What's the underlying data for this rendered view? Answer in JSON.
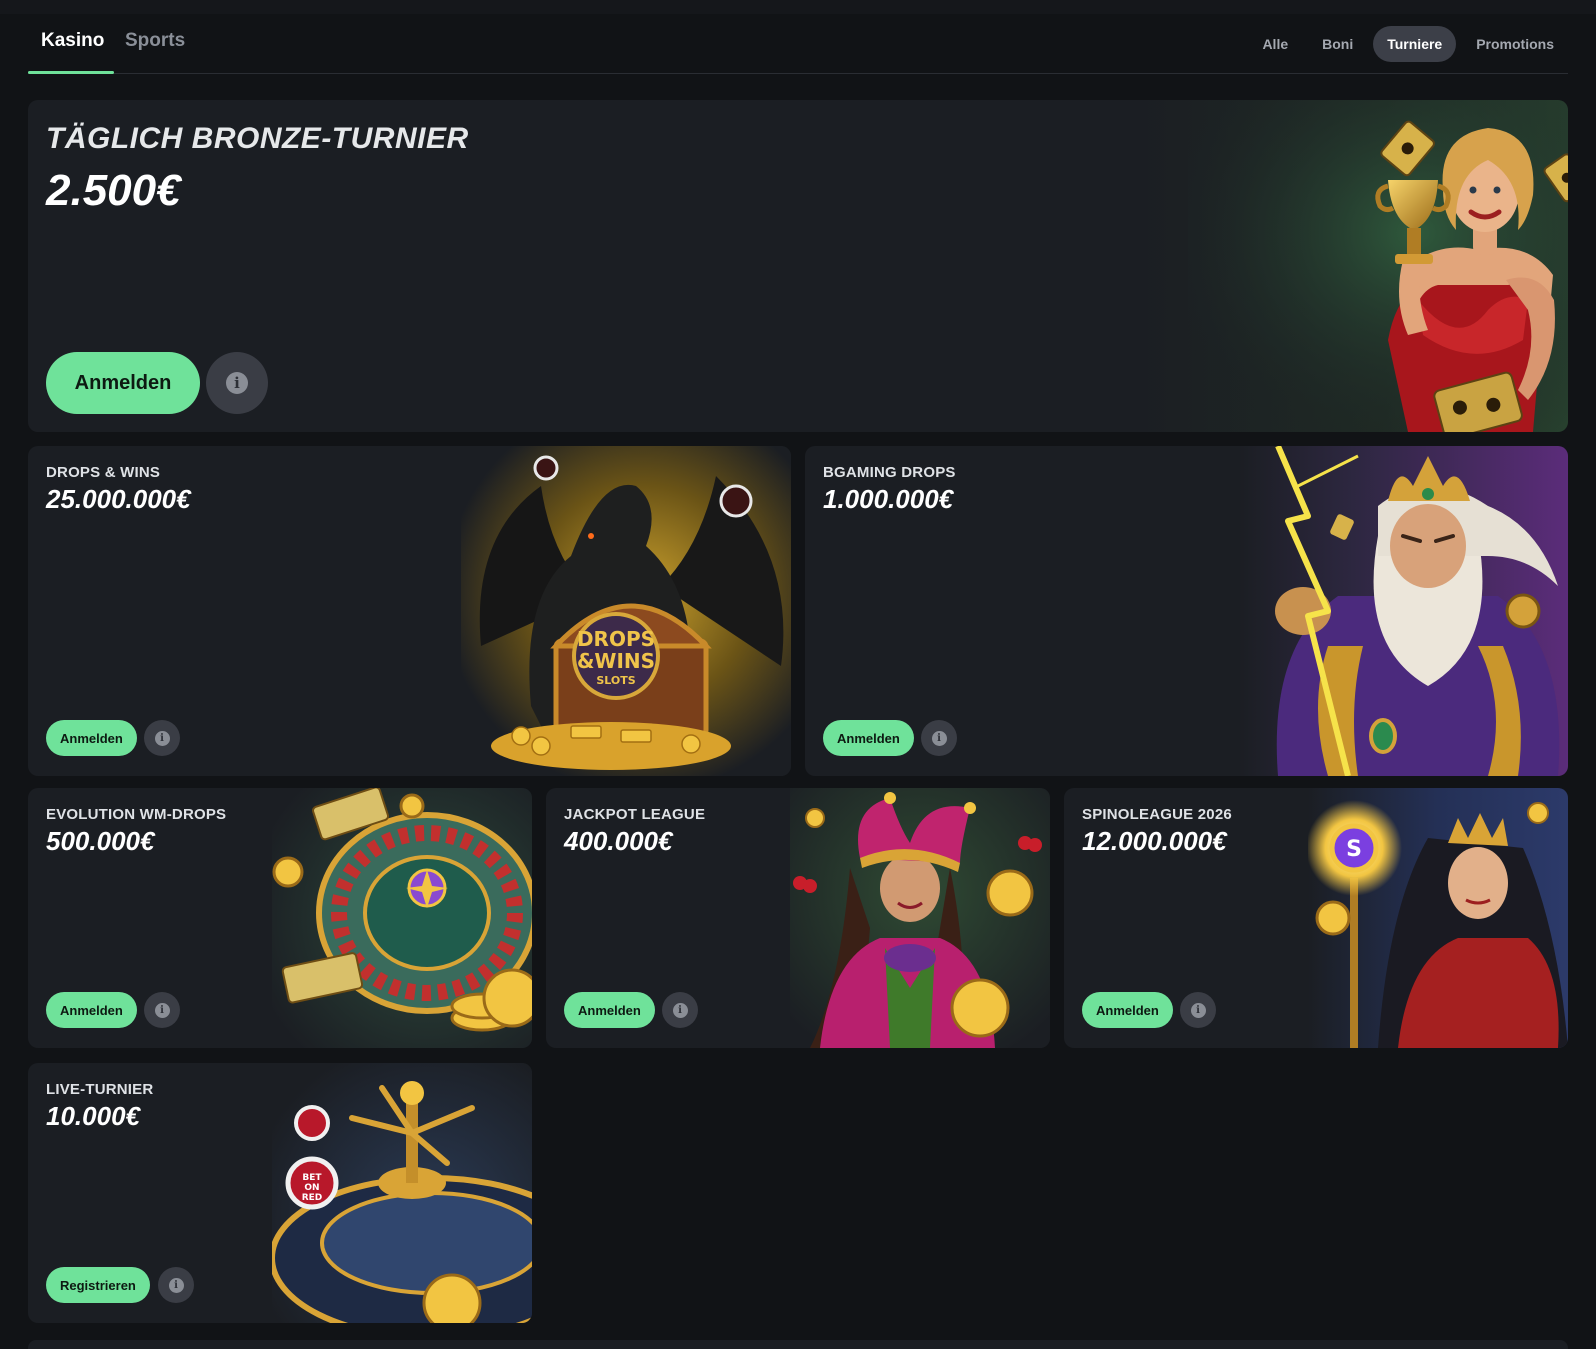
{
  "nav": {
    "tabs": [
      {
        "label": "Kasino",
        "active": true
      },
      {
        "label": "Sports",
        "active": false
      }
    ],
    "filters": [
      {
        "label": "Alle",
        "active": false
      },
      {
        "label": "Boni",
        "active": false
      },
      {
        "label": "Turniere",
        "active": true
      },
      {
        "label": "Promotions",
        "active": false
      }
    ]
  },
  "cards": [
    {
      "title": "TÄGLICH BRONZE-TURNIER",
      "prize": "2.500€",
      "button": "Anmelden",
      "art": "showgirl-trophy-illustration"
    },
    {
      "title": "DROPS & WINS",
      "prize": "25.000.000€",
      "button": "Anmelden",
      "art": "dragon-treasure-chest-illustration",
      "art_text": "DROPS & WINS SLOTS"
    },
    {
      "title": "BGAMING DROPS",
      "prize": "1.000.000€",
      "button": "Anmelden",
      "art": "zeus-lightning-illustration"
    },
    {
      "title": "EVOLUTION WM-DROPS",
      "prize": "500.000€",
      "button": "Anmelden",
      "art": "roulette-wheel-illustration"
    },
    {
      "title": "JACKPOT LEAGUE",
      "prize": "400.000€",
      "button": "Anmelden",
      "art": "jester-woman-illustration"
    },
    {
      "title": "SPINOLEAGUE 2026",
      "prize": "12.000.000€",
      "button": "Anmelden",
      "art": "empress-with-staff-illustration"
    },
    {
      "title": "LIVE-TURNIER",
      "prize": "10.000€",
      "button": "Registrieren",
      "art": "golden-roulette-illustration",
      "art_text": "BET ON RED"
    }
  ],
  "colors": {
    "accent": "#6fe29a",
    "background": "#111316",
    "card": "#1b1e23"
  },
  "icons": {
    "info": "info-icon"
  }
}
